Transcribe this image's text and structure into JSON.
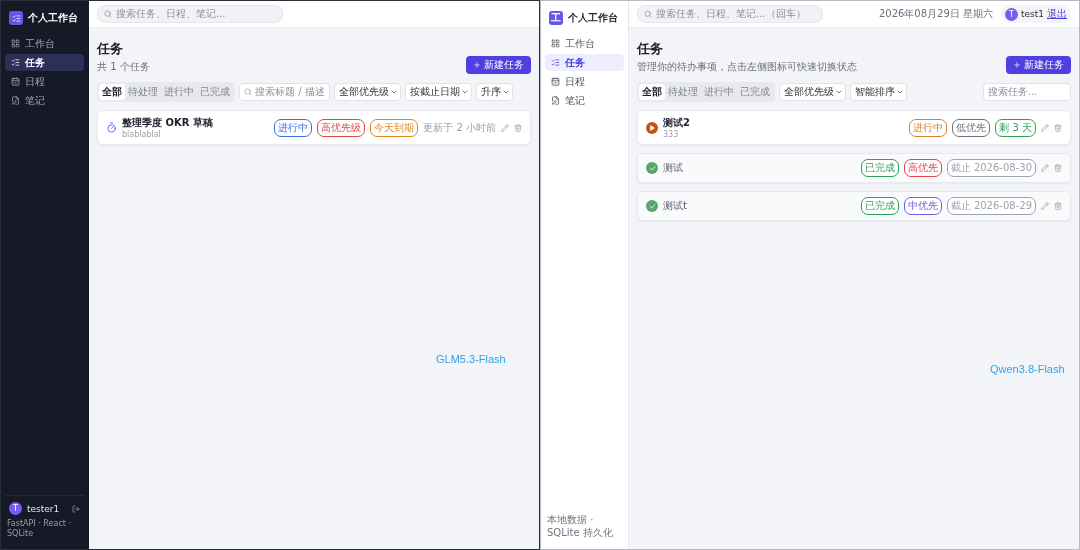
{
  "panels": [
    {
      "kind": "dark",
      "caption": "GLM5.3-Flash",
      "brand": {
        "title": "个人工作台"
      },
      "nav": [
        {
          "label": "工作台",
          "selected": false
        },
        {
          "label": "任务",
          "selected": true
        },
        {
          "label": "日程",
          "selected": false
        },
        {
          "label": "笔记",
          "selected": false
        }
      ],
      "user": {
        "initial": "T",
        "name": "tester1"
      },
      "footer": "FastAPI · React · SQLite",
      "search": {
        "placeholder": "搜索任务、日程、笔记..."
      },
      "page": {
        "title": "任务",
        "subtitle": "共 1 个任务",
        "new_button": "新建任务"
      },
      "filter_tabs": [
        {
          "label": "全部",
          "selected": true
        },
        {
          "label": "待处理",
          "selected": false
        },
        {
          "label": "进行中",
          "selected": false
        },
        {
          "label": "已完成",
          "selected": false
        }
      ],
      "filter_search": {
        "kind": "inline",
        "placeholder": "搜索标题 / 描述"
      },
      "selects": [
        "全部优先级",
        "按截止日期",
        "升序"
      ],
      "tasks": [
        {
          "kind": "timer",
          "completed": false,
          "title": "整理季度 OKR 草稿",
          "description": "blablablal",
          "badges": [
            {
              "text": "进行中",
              "color": "#3b6fe0"
            },
            {
              "text": "高优先级",
              "color": "#e0464b"
            },
            {
              "text": "今天到期",
              "color": "#e08a1e"
            }
          ],
          "updated": "更新于 2 小时前"
        }
      ]
    },
    {
      "kind": "light",
      "caption": "Qwen3.8-Flash",
      "brand": {
        "title": "个人工作台",
        "logo_text": "工"
      },
      "nav": [
        {
          "label": "工作台",
          "selected": false
        },
        {
          "label": "任务",
          "selected": true
        },
        {
          "label": "日程",
          "selected": false
        },
        {
          "label": "笔记",
          "selected": false
        }
      ],
      "footer": "本地数据 · SQLite 持久化",
      "search": {
        "placeholder": "搜索任务、日程、笔记...（回车）"
      },
      "topbar": {
        "date": "2026年08月29日 星期六",
        "user_initial": "T",
        "user_name": "test1",
        "logout": "退出"
      },
      "page": {
        "title": "任务",
        "subtitle": "管理你的待办事项，点击左侧图标可快速切换状态",
        "new_button": "新建任务"
      },
      "filter_tabs": [
        {
          "label": "全部",
          "selected": true
        },
        {
          "label": "待处理",
          "selected": false
        },
        {
          "label": "进行中",
          "selected": false
        },
        {
          "label": "已完成",
          "selected": false
        }
      ],
      "filter_search": {
        "kind": "right",
        "placeholder": "搜索任务..."
      },
      "selects": [
        "全部优先级",
        "智能排序"
      ],
      "tasks": [
        {
          "kind": "play",
          "completed": false,
          "title": "测试2",
          "description": "333",
          "badges": [
            {
              "text": "进行中",
              "color": "#d9822b"
            },
            {
              "text": "低优先",
              "color": "#6b7280"
            },
            {
              "text": "剩 3 天",
              "color": "#2f9e5b"
            }
          ]
        },
        {
          "kind": "check",
          "completed": true,
          "title": "测试",
          "badges": [
            {
              "text": "已完成",
              "color": "#2f9e5b"
            },
            {
              "text": "高优先",
              "color": "#e0464b"
            },
            {
              "text": "截止 2026-08-30",
              "color": "#9ca3af"
            }
          ]
        },
        {
          "kind": "check",
          "completed": true,
          "title": "测试t",
          "badges": [
            {
              "text": "已完成",
              "color": "#2f9e5b"
            },
            {
              "text": "中优先",
              "color": "#6d5ce8"
            },
            {
              "text": "截止 2026-08-29",
              "color": "#9ca3af"
            }
          ]
        }
      ]
    }
  ]
}
